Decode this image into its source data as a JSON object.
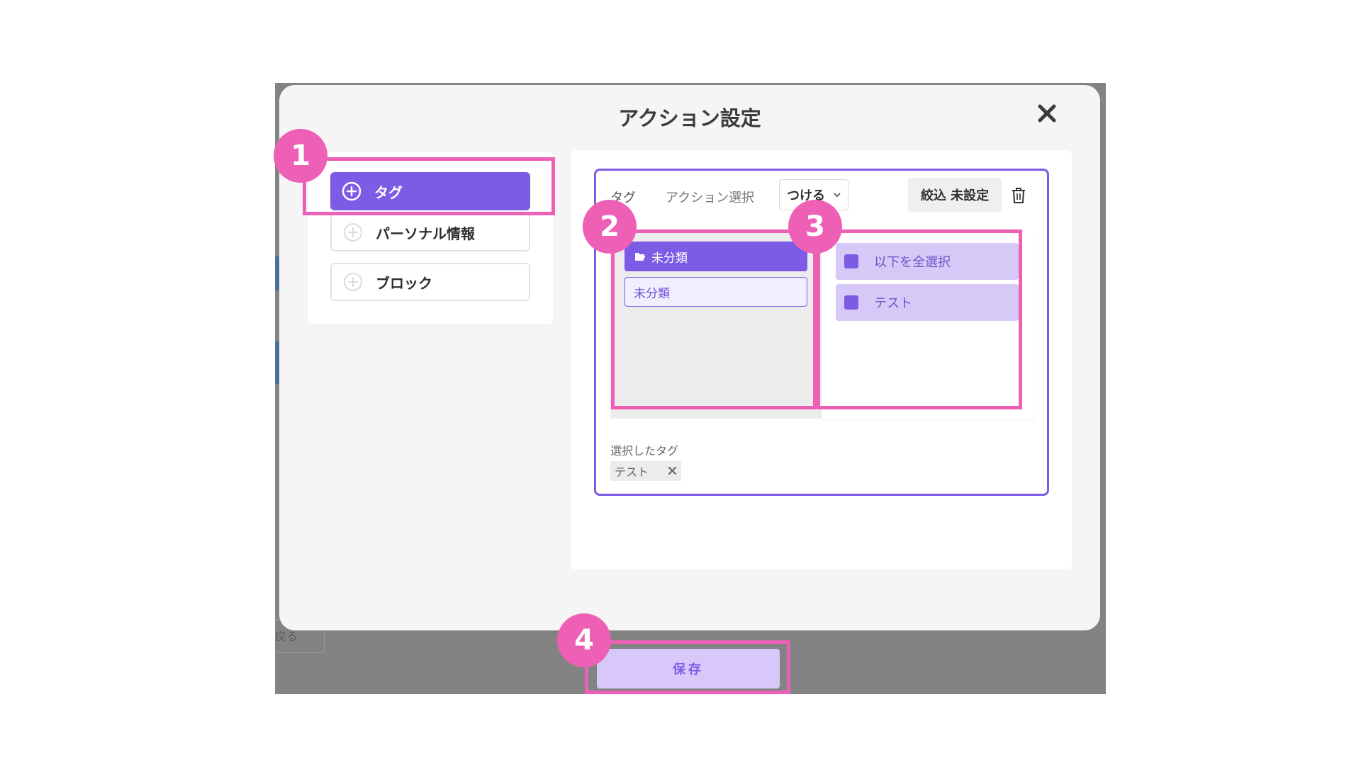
{
  "modal": {
    "title": "アクション設定"
  },
  "left_menu": {
    "items": [
      {
        "label": "タグ",
        "active": true
      },
      {
        "label": "パーソナル情報",
        "active": false
      },
      {
        "label": "ブロック",
        "active": false
      }
    ]
  },
  "action_card": {
    "tag_label": "タグ",
    "action_select_label": "アクション選択",
    "action_value": "つける",
    "filter_label": "絞込 未設定",
    "folder_header": "未分類",
    "folder_item": "未分類",
    "tags": [
      {
        "label": "以下を全選択"
      },
      {
        "label": "テスト"
      }
    ],
    "selected_label": "選択したタグ",
    "selected_chip": "テスト"
  },
  "footer": {
    "save_label": "保存"
  },
  "annotations": {
    "badges": [
      "1",
      "2",
      "3",
      "4"
    ]
  },
  "colors": {
    "accent": "#7c5ce4",
    "highlight": "#ee5fb6",
    "tag_row": "#d6c9f7",
    "save_bg": "#d8c8fa"
  },
  "background_fragments": [
    "戻る"
  ]
}
